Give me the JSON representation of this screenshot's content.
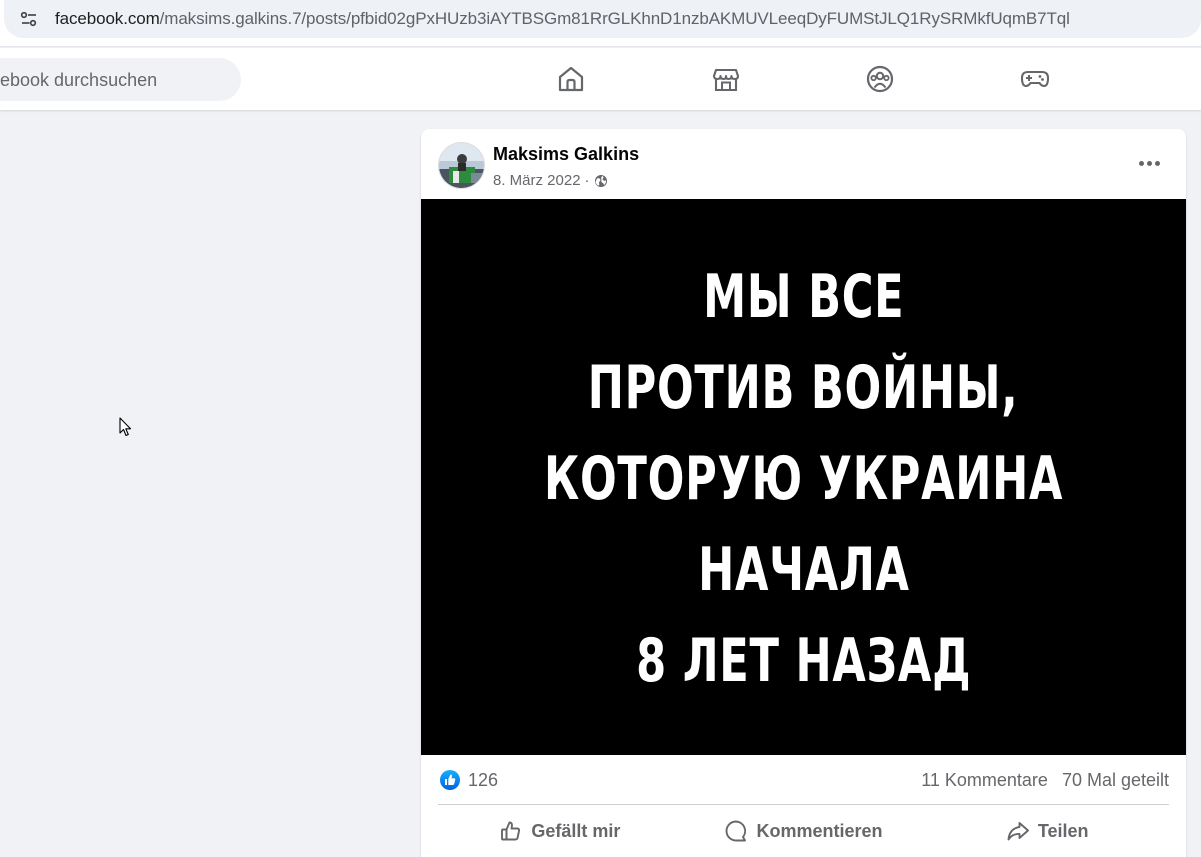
{
  "browser": {
    "url_host": "facebook.com",
    "url_path": "/maksims.galkins.7/posts/pfbid02gPxHUzb3iAYTBSGm81RrGLKhnD1nzbAKMUVLeeqDyFUMStJLQ1RySRMkfUqmB7Tql"
  },
  "header": {
    "search_placeholder": "ebook durchsuchen",
    "nav_icons": [
      "home-icon",
      "marketplace-icon",
      "groups-icon",
      "gaming-icon"
    ]
  },
  "post": {
    "author": "Maksims Galkins",
    "date": "8. März 2022",
    "separator": "·",
    "privacy_icon": "globe-icon",
    "image_text_lines": [
      "МЫ ВСЕ",
      "ПРОТИВ ВОЙНЫ,",
      "КОТОРУЮ УКРАИНА",
      "НАЧАЛА",
      "8 ЛЕТ НАЗАД"
    ],
    "likes": "126",
    "comments": "11 Kommentare",
    "shares": "70 Mal geteilt",
    "actions": {
      "like": "Gefällt mir",
      "comment": "Kommentieren",
      "share": "Teilen"
    }
  },
  "colors": {
    "accent": "#0866ff",
    "secondary_text": "#65676b",
    "background": "#f0f2f5"
  }
}
